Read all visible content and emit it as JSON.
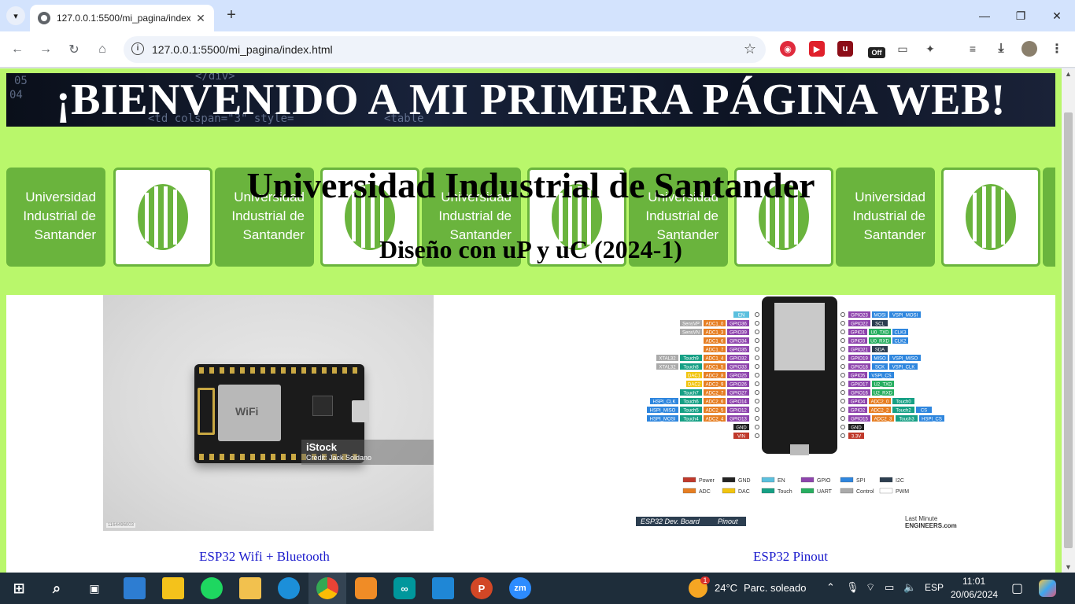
{
  "browser": {
    "tab_title": "127.0.0.1:5500/mi_pagina/index",
    "url": "127.0.0.1:5500/mi_pagina/index.html",
    "extension_badge": "Off"
  },
  "page": {
    "banner_title": "¡BIENVENIDO A MI PRIMERA PÁGINA WEB!",
    "banner_code": [
      "</div>",
      "04",
      "05",
      "<td colspan=\"3\" style=",
      "<table"
    ],
    "university": "Universidad Industrial de Santander",
    "course": "Diseño con uP y uC (2024-1)",
    "logo_text": "Universidad Industrial de Santander",
    "logo_mark": "UIS",
    "photo_watermark": "iStock",
    "photo_credit": "Credit: Jack Soldano",
    "photo_id": "1164496003",
    "board_wifi": "WiFi",
    "board_fc": "FC",
    "caption_left": "ESP32 Wifi + Bluetooth",
    "caption_right": "ESP32 Pinout",
    "pinout": {
      "left_pins": [
        [
          "",
          "",
          "EN"
        ],
        [
          "SensVP",
          "ADC1_0",
          "GPIO36"
        ],
        [
          "SensVN",
          "ADC1_3",
          "GPIO39"
        ],
        [
          "",
          "ADC1_6",
          "GPIO34"
        ],
        [
          "",
          "ADC1_7",
          "GPIO35"
        ],
        [
          "XTAL32",
          "Touch9",
          "ADC1_4",
          "GPIO32"
        ],
        [
          "XTAL32",
          "Touch8",
          "ADC1_5",
          "GPIO33"
        ],
        [
          "DAC1",
          "ADC2_8",
          "GPIO25"
        ],
        [
          "DAC2",
          "ADC2_9",
          "GPIO26"
        ],
        [
          "Touch7",
          "ADC2_7",
          "GPIO27"
        ],
        [
          "HSPI_CLK",
          "Touch6",
          "ADC2_6",
          "GPIO14"
        ],
        [
          "HSPI_MISO",
          "Touch5",
          "ADC2_5",
          "GPIO12"
        ],
        [
          "HSPI_MOSI",
          "Touch4",
          "ADC2_4",
          "GPIO13"
        ],
        [
          "",
          "",
          "GND"
        ],
        [
          "",
          "",
          "VIN"
        ]
      ],
      "right_pins": [
        [
          "GPIO23",
          "MOSI",
          "VSPI_MOSI"
        ],
        [
          "GPIO22",
          "SCL"
        ],
        [
          "GPIO1",
          "U0_TXD",
          "CLK3"
        ],
        [
          "GPIO3",
          "U0_RXD",
          "CLK2"
        ],
        [
          "GPIO21",
          "SDA"
        ],
        [
          "GPIO19",
          "MISO",
          "VSPI_MISO"
        ],
        [
          "GPIO18",
          "SCK",
          "VSPI_CLK"
        ],
        [
          "GPIO5",
          "VSPI_CS"
        ],
        [
          "GPIO17",
          "U2_TXD"
        ],
        [
          "GPIO16",
          "U2_RXD"
        ],
        [
          "GPIO4",
          "ADC2_0",
          "Touch0"
        ],
        [
          "GPIO2",
          "ADC2_2",
          "Touch2",
          "CS"
        ],
        [
          "GPIO15",
          "ADC2_3",
          "Touch3",
          "HSPI_CS"
        ],
        [
          "GND"
        ],
        [
          "3.3V"
        ]
      ],
      "legend": [
        "Power",
        "GND",
        "EN",
        "GPIO",
        "SPI",
        "I2C",
        "ADC",
        "DAC",
        "Touch",
        "UART",
        "Control",
        "PWM"
      ],
      "board_label": "ESP32 Dev. Board",
      "board_label_suffix": "Pinout",
      "brand_top": "Last Minute",
      "brand_bottom": "ENGINEERS.com"
    }
  },
  "taskbar": {
    "weather_temp": "24°C",
    "weather_text": "Parc. soleado",
    "lang": "ESP",
    "time": "11:01",
    "date": "20/06/2024",
    "weather_badge": "1"
  },
  "colors": {
    "page_bg": "#b9f76b",
    "uis_green": "#6ab43d",
    "link": "#1a1acc"
  }
}
